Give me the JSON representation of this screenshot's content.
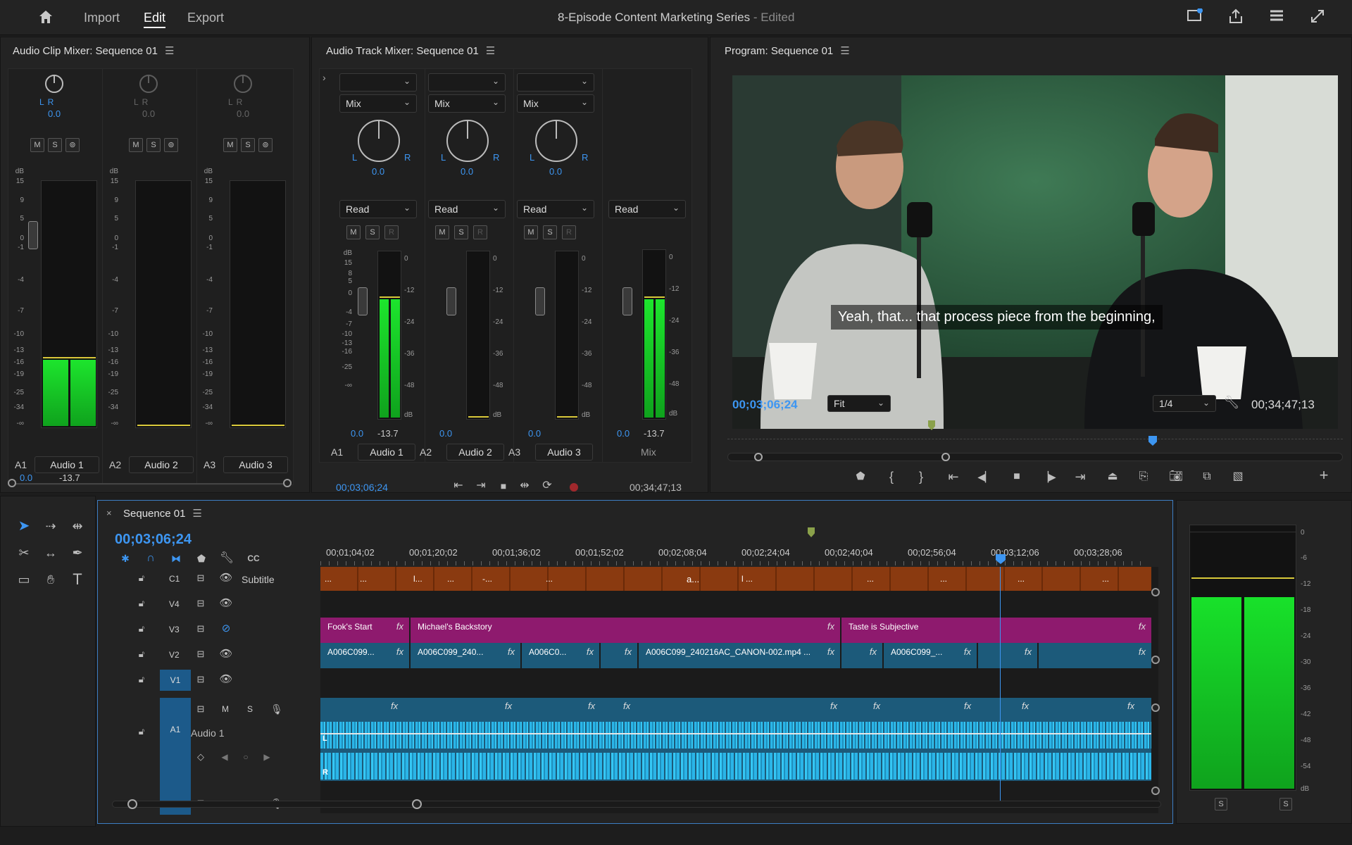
{
  "topbar": {
    "nav": [
      "Import",
      "Edit",
      "Export"
    ],
    "project_title": "8-Episode Content Marketing Series",
    "project_status": "- Edited"
  },
  "clip_mixer": {
    "title": "Audio Clip Mixer: Sequence 01",
    "channels": [
      {
        "id": "A1",
        "name": "Audio 1",
        "pan": "0.0",
        "level": "0.0",
        "peak": "-13.7",
        "lr": "L R"
      },
      {
        "id": "A2",
        "name": "Audio 2",
        "pan": "0.0",
        "lr": "L R"
      },
      {
        "id": "A3",
        "name": "Audio 3",
        "pan": "0.0",
        "lr": "L R"
      }
    ],
    "scale": [
      "dB",
      "15",
      "9",
      "5",
      "0",
      "-1",
      "-4",
      "-7",
      "-10",
      "-13",
      "-16",
      "-19",
      "-25",
      "-34",
      "-∞"
    ],
    "msr": [
      "M",
      "S",
      "⊚"
    ]
  },
  "track_mixer": {
    "title": "Audio Track Mixer: Sequence 01",
    "channels": [
      {
        "id": "A1",
        "name": "Audio 1",
        "mode": "Mix",
        "auto": "Read",
        "pan": "0.0",
        "vol": "0.0",
        "peak": "-13.7"
      },
      {
        "id": "A2",
        "name": "Audio 2",
        "mode": "Mix",
        "auto": "Read",
        "pan": "0.0",
        "vol": "0.0"
      },
      {
        "id": "A3",
        "name": "Audio 3",
        "mode": "Mix",
        "auto": "Read",
        "pan": "0.0",
        "vol": "0.0"
      },
      {
        "id": "",
        "name": "Mix",
        "auto": "Read",
        "vol": "0.0",
        "peak": "-13.7"
      }
    ],
    "left_scale": [
      "dB",
      "15",
      "8",
      "5",
      "0",
      "-4",
      "-7",
      "-10",
      "-13",
      "-16",
      "-25",
      "-∞"
    ],
    "right_scale": [
      "0",
      "-12",
      "-24",
      "-36",
      "-48",
      "dB"
    ],
    "msr": [
      "M",
      "S",
      "R"
    ],
    "timecode_left": "00;03;06;24",
    "timecode_right": "00;34;47;13"
  },
  "program": {
    "title": "Program: Sequence 01",
    "subtitle": "Yeah, that... that process piece from the beginning,",
    "timecode": "00;03;06;24",
    "zoom": "Fit",
    "resolution": "1/4",
    "duration": "00;34;47;13",
    "playhead_fraction": 0.62
  },
  "timeline": {
    "title": "Sequence 01",
    "timecode": "00;03;06;24",
    "ruler": [
      "00;01;04;02",
      "00;01;20;02",
      "00;01;36;02",
      "00;01;52;02",
      "00;02;08;04",
      "00;02;24;04",
      "00;02;40;04",
      "00;02;56;04",
      "00;03;12;06",
      "00;03;28;06"
    ],
    "tracks": [
      {
        "id": "C1",
        "name": "Subtitle"
      },
      {
        "id": "V4"
      },
      {
        "id": "V3"
      },
      {
        "id": "V2"
      },
      {
        "id": "V1"
      },
      {
        "id": "A1",
        "name": "Audio 1"
      }
    ],
    "subtitle_clip_labels": [
      "...",
      "...",
      "l...",
      "...",
      "-...",
      "...",
      "a...",
      "l ...",
      "...",
      "...",
      "...",
      "..."
    ],
    "v3_clips": [
      "Fook's Start",
      "Michael's Backstory",
      "Taste is Subjective"
    ],
    "v2_clips": [
      "A006C099...",
      "A006C099_240...",
      "A006C0...",
      "A006C099_240216AC_CANON-002.mp4 ...",
      "A006C099_..."
    ],
    "audio_controls": [
      "M",
      "S"
    ],
    "fx": "fx",
    "lr": [
      "L",
      "R"
    ]
  },
  "meter_right": {
    "scale": [
      "0",
      "-6",
      "-12",
      "-18",
      "-24",
      "-30",
      "-36",
      "-42",
      "-48",
      "-54",
      "dB"
    ],
    "solo": [
      "S",
      "S"
    ],
    "level_fraction": 0.82
  },
  "colors": {
    "accent": "#3d96f2",
    "meter_green": "#1de52d",
    "subtitle_track": "#8a3a10",
    "v3_track": "#8e1a6e",
    "v2_track": "#1c5a7a",
    "audio_track": "#2ab5e8"
  }
}
